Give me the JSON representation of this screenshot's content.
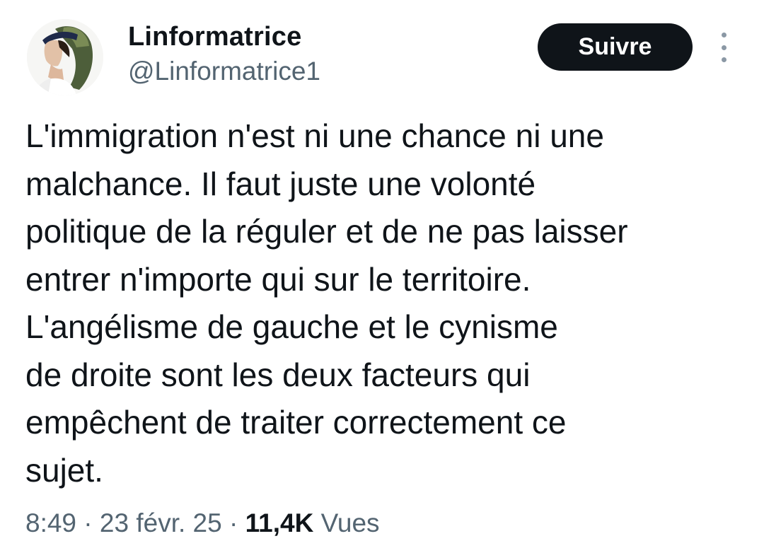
{
  "author": {
    "display_name": "Linformatrice",
    "handle": "@Linformatrice1",
    "avatar": "woman-with-headscarf-avatar"
  },
  "actions": {
    "follow_label": "Suivre",
    "more_icon": "vertical-ellipsis-icon"
  },
  "tweet": {
    "lines": [
      "L'immigration n'est ni une chance ni une",
      "malchance. Il faut juste une volonté",
      "politique de la réguler et de ne pas laisser",
      "entrer n'importe qui sur le territoire.",
      "L'angélisme de gauche et le cynisme",
      "de droite sont les deux facteurs qui",
      "empêchent de traiter correctement ce",
      "sujet."
    ]
  },
  "meta": {
    "time": "8:49",
    "separator": " · ",
    "date": "23 févr. 25",
    "views_count": "11,4K",
    "views_label": "Vues"
  },
  "colors": {
    "text_primary": "#0f1419",
    "text_secondary": "#536471",
    "button_bg": "#0f1419",
    "button_text": "#ffffff",
    "background": "#ffffff"
  }
}
